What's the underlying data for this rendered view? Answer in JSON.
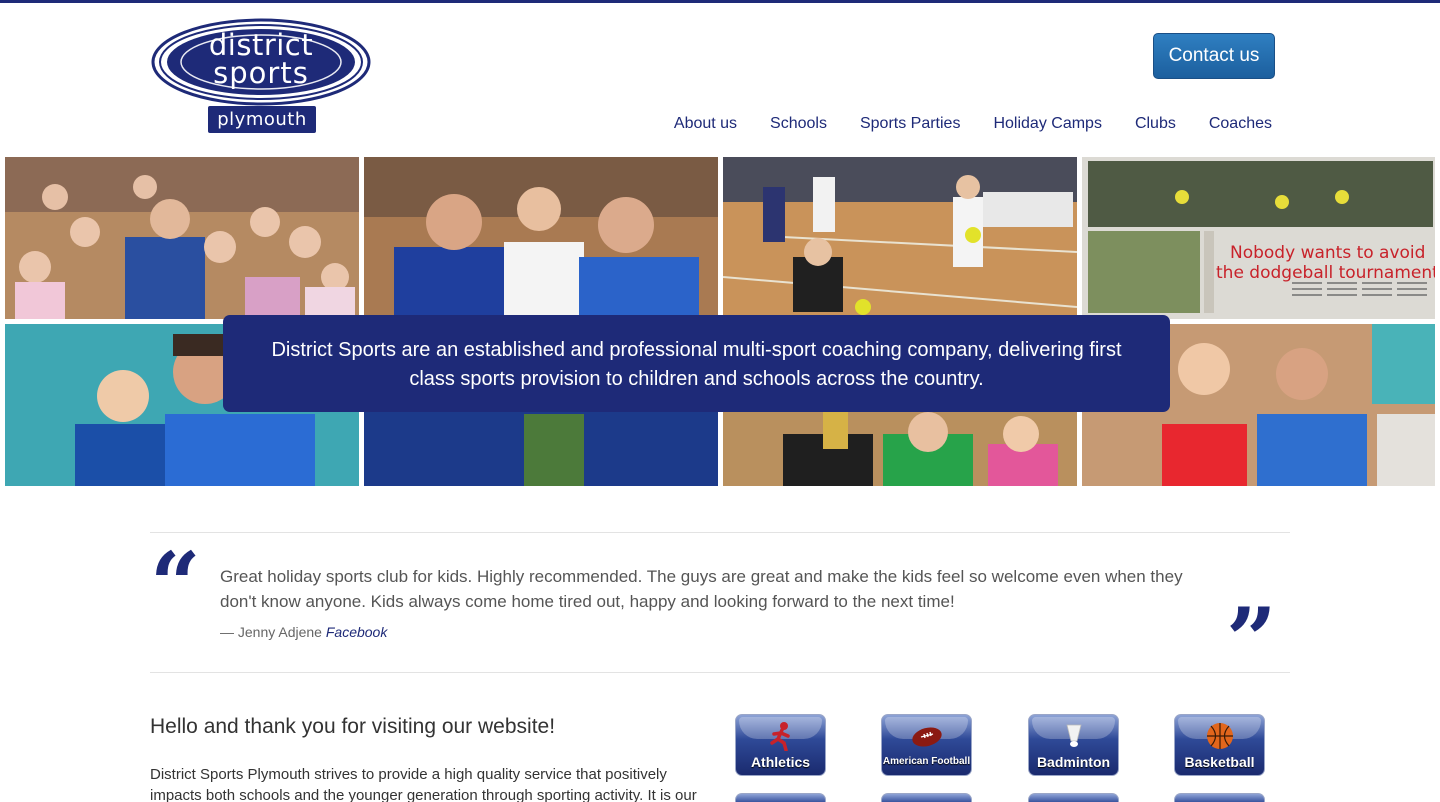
{
  "brand": {
    "line1": "district",
    "line2": "sports",
    "city": "plymouth",
    "color": "#1e2a78"
  },
  "header": {
    "contact_label": "Contact us"
  },
  "nav": {
    "items": [
      {
        "label": "About us"
      },
      {
        "label": "Schools"
      },
      {
        "label": "Sports Parties"
      },
      {
        "label": "Holiday Camps"
      },
      {
        "label": "Clubs"
      },
      {
        "label": "Coaches"
      }
    ]
  },
  "hero": {
    "caption": "District Sports are an established and professional multi-sport coaching company, delivering first class sports provision to children and schools across the country.",
    "newspaper_headline_1": "Nobody wants to avoid",
    "newspaper_headline_2": "the dodgeball tournament"
  },
  "testimonial": {
    "open_mark": "“",
    "close_mark": "”",
    "text": "Great holiday sports club for kids. Highly recommended. The guys are great and make the kids feel so welcome even when they don't know anyone. Kids always come home tired out, happy and looking forward to the next time!",
    "author": "— Jenny Adjene",
    "source": "Facebook"
  },
  "welcome": {
    "title": "Hello and thank you for visiting our website!",
    "text": "District Sports Plymouth strives to provide a high quality service that positively impacts both schools and the younger generation through sporting activity. It is our"
  },
  "sports": [
    {
      "label": "Athletics",
      "icon": "runner-icon"
    },
    {
      "label": "American Football",
      "icon": "american-football-icon"
    },
    {
      "label": "Badminton",
      "icon": "shuttlecock-icon"
    },
    {
      "label": "Basketball",
      "icon": "basketball-icon"
    }
  ]
}
